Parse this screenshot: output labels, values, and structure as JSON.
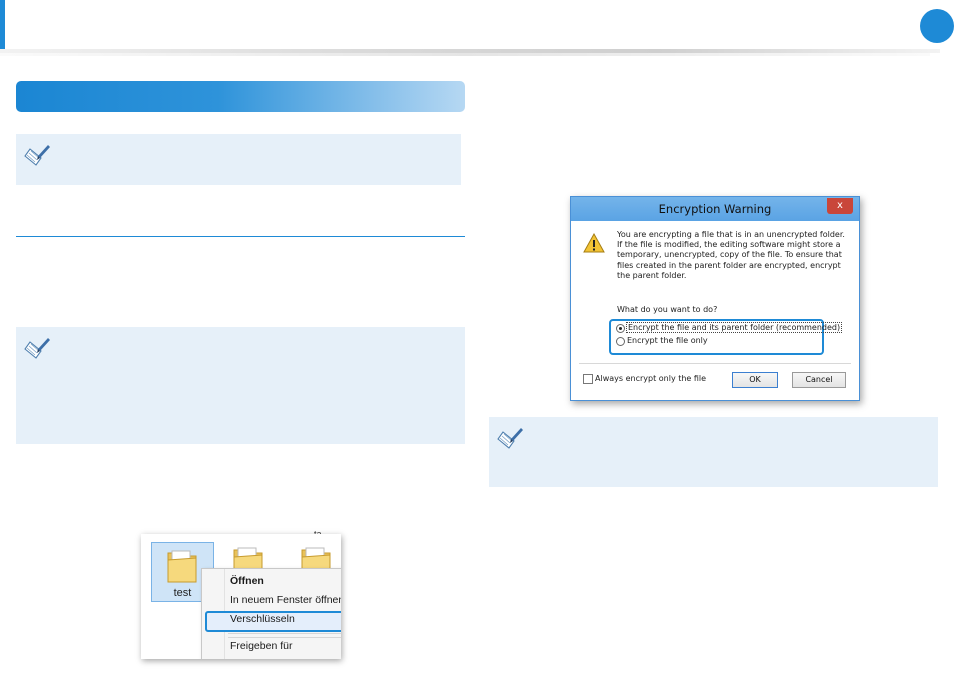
{
  "explorer": {
    "top_fragment": "ta",
    "folder_label": "test",
    "context_menu": [
      {
        "label": "Öffnen",
        "bold": true
      },
      {
        "label": "In neuem Fenster öffnen",
        "bold": false
      },
      {
        "label": "Verschlüsseln",
        "bold": false,
        "highlighted": true
      },
      {
        "label": "Freigeben für",
        "bold": false
      }
    ]
  },
  "dialog": {
    "title": "Encryption Warning",
    "close_label": "x",
    "message": "You are encrypting a file that is in an unencrypted folder. If the file is modified, the editing software might store a temporary, unencrypted, copy of the file. To ensure that files created in the parent folder are encrypted, encrypt the parent folder.",
    "question": "What do you want to do?",
    "option1": "Encrypt the file and its parent folder (recommended)",
    "option2": "Encrypt the file only",
    "checkbox_label": "Always encrypt only the file",
    "ok_label": "OK",
    "cancel_label": "Cancel"
  },
  "colors": {
    "accent": "#1e8ad6",
    "note_background": "#e6f0f9"
  }
}
